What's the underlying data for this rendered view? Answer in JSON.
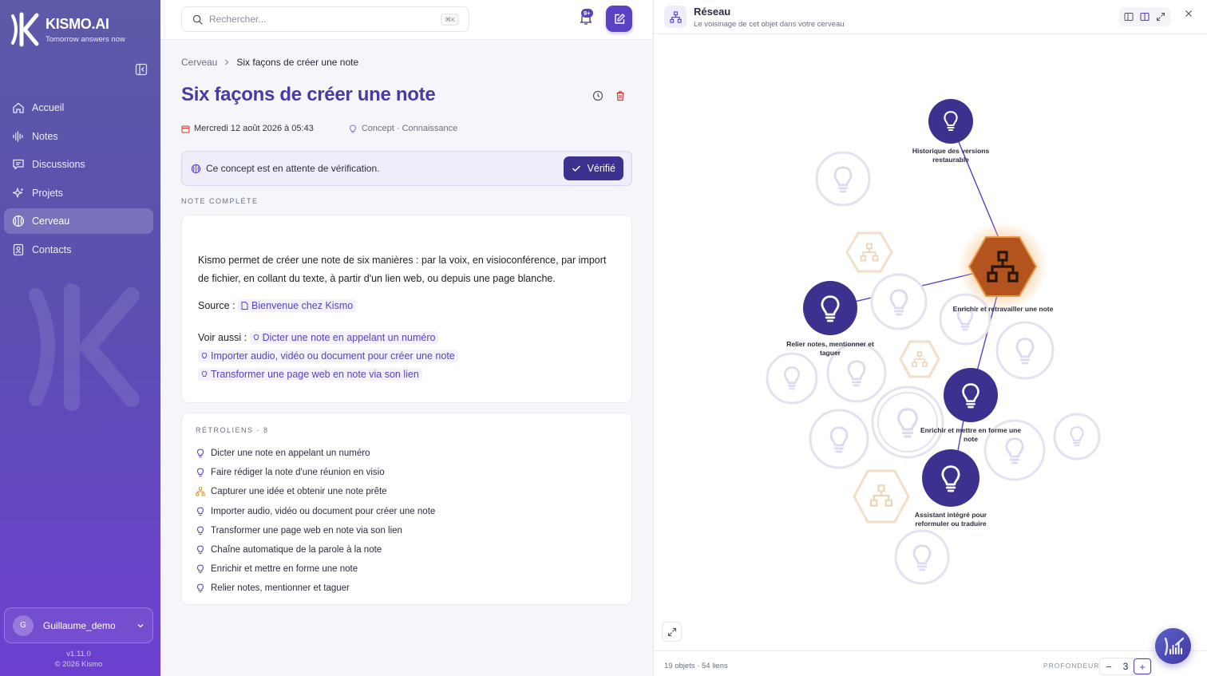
{
  "brand": {
    "name": "KISMO.AI",
    "tagline": "Tomorrow answers now"
  },
  "sidebar": {
    "items": [
      {
        "label": "Accueil",
        "icon": "home-icon"
      },
      {
        "label": "Notes",
        "icon": "waveform-icon"
      },
      {
        "label": "Discussions",
        "icon": "chat-icon"
      },
      {
        "label": "Projets",
        "icon": "sparkle-icon"
      },
      {
        "label": "Cerveau",
        "icon": "brain-icon",
        "active": true
      },
      {
        "label": "Contacts",
        "icon": "contact-icon"
      }
    ],
    "user": {
      "initial": "G",
      "name": "Guillaume_demo"
    },
    "version": "v1.11.0",
    "copyright": "© 2026 Kismo"
  },
  "search": {
    "placeholder": "Rechercher...",
    "shortcut": "⌘K"
  },
  "notifications": {
    "badge": "9+"
  },
  "breadcrumb": {
    "root": "Cerveau",
    "current": "Six façons de créer une note"
  },
  "note": {
    "title": "Six façons de créer une note",
    "date": "Mercredi 12 août 2026 à 05:43",
    "category": "Concept · Connaissance",
    "notice": "Ce concept est en attente de vérification.",
    "verify_label": "Vérifié",
    "section_label": "NOTE COMPLÈTE",
    "body": "Kismo permet de créer une note de six manières : par la voix, en visioconférence, par import de fichier, en collant du texte, à partir d'un lien web, ou depuis une page blanche.",
    "source_label": "Source :",
    "source_link": "Bienvenue chez Kismo",
    "see_also_label": "Voir aussi :",
    "see_also": [
      "Dicter une note en appelant un numéro",
      "Importer audio, vidéo ou document pour créer une note",
      "Transformer une page web en note via son lien"
    ]
  },
  "backlinks": {
    "title": "RÉTROLIENS · 8",
    "items": [
      {
        "label": "Dicter une note en appelant un numéro",
        "icon": "lightbulb-icon"
      },
      {
        "label": "Faire rédiger la note d'une réunion en visio",
        "icon": "lightbulb-icon"
      },
      {
        "label": "Capturer une idée et obtenir une note prête",
        "icon": "workflow-icon"
      },
      {
        "label": "Importer audio, vidéo ou document pour créer une note",
        "icon": "lightbulb-icon"
      },
      {
        "label": "Transformer une page web en note via son lien",
        "icon": "lightbulb-icon"
      },
      {
        "label": "Chaîne automatique de la parole à la note",
        "icon": "lightbulb-icon"
      },
      {
        "label": "Enrichir et mettre en forme une note",
        "icon": "lightbulb-icon"
      },
      {
        "label": "Relier notes, mentionner et taguer",
        "icon": "lightbulb-icon"
      }
    ]
  },
  "panel": {
    "title": "Réseau",
    "subtitle": "Le voisinage de cet objet dans votre cerveau",
    "stats": "19 objets · 54 liens",
    "depth_label": "PROFONDEUR",
    "depth_value": "3",
    "nodes": [
      {
        "label": "Historique des versions restaurable"
      },
      {
        "label": "Enrichir et retravailler une note"
      },
      {
        "label": "Relier notes, mentionner et taguer"
      },
      {
        "label": "Enrichir et mettre en forme une note"
      },
      {
        "label": "Assistant intégré pour reformuler ou traduire"
      }
    ]
  },
  "colors": {
    "accent": "#5b3fc4",
    "title": "#4a3aa6",
    "hub": "#b3541e",
    "danger": "#d9342b"
  }
}
